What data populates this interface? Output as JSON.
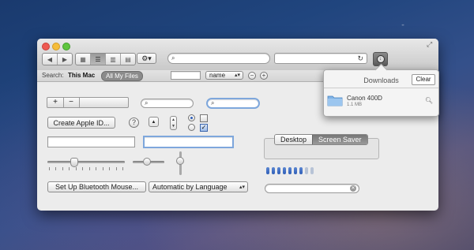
{
  "window": {
    "nav_back": "◀",
    "nav_forward": "▶",
    "view_modes": [
      "icon-view",
      "list-view",
      "column-view",
      "coverflow-view"
    ],
    "action_menu": "⚙▾",
    "search_icon": "⌕",
    "reload_icon": "↻",
    "downloads_icon": "download-icon",
    "resize_icon": "⤢"
  },
  "scope_bar": {
    "search_label": "Search:",
    "this_mac": "This Mac",
    "all_my_files": "All My Files",
    "name_popup": "name",
    "minus": "−",
    "plus": "+"
  },
  "controls": {
    "add_label": "+",
    "remove_label": "−",
    "create_apple_id": "Create Apple ID...",
    "help": "?",
    "disclosure_up": "▲",
    "stepper_up": "▲",
    "stepper_down": "▼",
    "checkbox_checked": "✓",
    "setup_bluetooth": "Set Up Bluetooth Mouse...",
    "language_popup": "Automatic by Language",
    "popup_arrows": "▴▾",
    "clear_icon": "✕"
  },
  "tabs": [
    "Desktop",
    "Screen Saver"
  ],
  "level_indicator": {
    "value": 7,
    "max": 9
  },
  "downloads_popover": {
    "title": "Downloads",
    "clear_label": "Clear",
    "item_name": "Canon 400D",
    "item_size": "1.1 MB",
    "reveal_icon": "magnifier-icon"
  },
  "colors": {
    "accent": "#2f5fb8",
    "focus_ring": "#7ea7dc",
    "close": "#ee5a52",
    "minimize": "#f5bd3b",
    "zoom": "#5fc53f"
  }
}
